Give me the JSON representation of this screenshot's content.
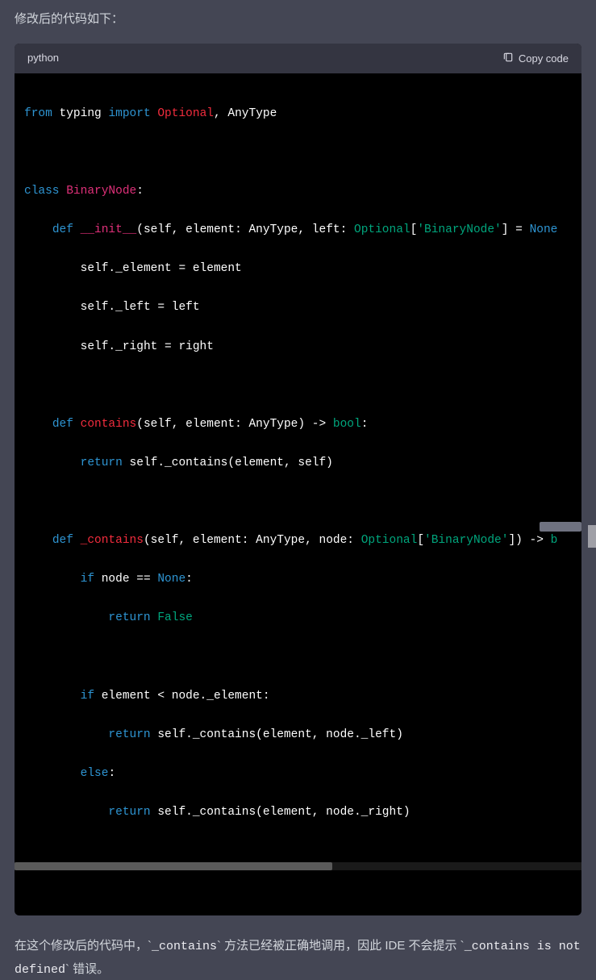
{
  "intro": "修改后的代码如下：",
  "code_header": {
    "language": "python",
    "copy_label": "Copy code"
  },
  "code": {
    "l1": {
      "kw1": "from",
      "mod": "typing",
      "kw2": "import",
      "t1": "Optional",
      "comma": ", ",
      "t2": "AnyType"
    },
    "l2": "",
    "l3": {
      "kw": "class",
      "name": "BinaryNode",
      "colon": ":"
    },
    "l4": {
      "indent": "    ",
      "kw": "def",
      "name": "__init__",
      "sig1": "(self, element: AnyType, left: ",
      "opt": "Optional",
      "sig2": "[",
      "str": "'BinaryNode'",
      "sig3": "] = ",
      "none": "None"
    },
    "l5": {
      "indent": "        ",
      "text": "self._element = element"
    },
    "l6": {
      "indent": "        ",
      "text": "self._left = left"
    },
    "l7": {
      "indent": "        ",
      "text": "self._right = right"
    },
    "l8": "",
    "l9": {
      "indent": "    ",
      "kw": "def",
      "name": "contains",
      "sig": "(self, element: AnyType) -> ",
      "ret": "bool",
      "colon": ":"
    },
    "l10": {
      "indent": "        ",
      "kw": "return",
      "text": " self._contains(element, self)"
    },
    "l11": "",
    "l12": {
      "indent": "    ",
      "kw": "def",
      "name": "_contains",
      "sig1": "(self, element: AnyType, node: ",
      "opt": "Optional",
      "sig2": "[",
      "str": "'BinaryNode'",
      "sig3": "]) -> ",
      "ret": "b"
    },
    "l13": {
      "indent": "        ",
      "kw": "if",
      "text1": " node == ",
      "none": "None",
      "colon": ":"
    },
    "l14": {
      "indent": "            ",
      "kw": "return",
      "val": " False"
    },
    "l15": "",
    "l16": {
      "indent": "        ",
      "kw": "if",
      "text": " element < node._element:"
    },
    "l17": {
      "indent": "            ",
      "kw": "return",
      "text": " self._contains(element, node._left)"
    },
    "l18": {
      "indent": "        ",
      "kw": "else",
      "colon": ":"
    },
    "l19": {
      "indent": "            ",
      "kw": "return",
      "text": " self._contains(element, node._right)"
    }
  },
  "outro": {
    "t1": "在这个修改后的代码中，`",
    "c1": "_contains",
    "t2": "` 方法已经被正确地调用，因此 IDE 不会提示 `",
    "c2": "_contains is not defined",
    "t3": "` 错误。"
  }
}
